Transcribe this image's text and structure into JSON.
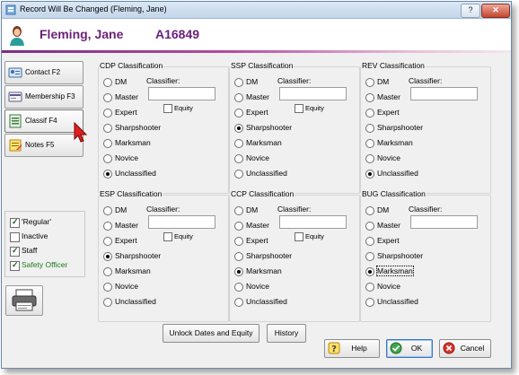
{
  "window": {
    "title": "Record Will Be Changed  (Fleming, Jane)",
    "help_glyph": "?",
    "close_glyph": "✕"
  },
  "header": {
    "name": "Fleming, Jane",
    "record_id": "A16849"
  },
  "nav": {
    "contact": "Contact  F2",
    "membership": "Membership F3",
    "classif": "Classif   F4",
    "notes": "Notes     F5"
  },
  "status": {
    "regular": {
      "label": "'Regular'",
      "checked": true
    },
    "inactive": {
      "label": "Inactive",
      "checked": false
    },
    "staff": {
      "label": "Staff",
      "checked": true
    },
    "safety_officer": {
      "label": "Safety Officer",
      "checked": true
    }
  },
  "classification": {
    "classifier_label": "Classifier:",
    "equity_label": "Equity",
    "levels": [
      "DM",
      "Master",
      "Expert",
      "Sharpshooter",
      "Marksman",
      "Novice",
      "Unclassified"
    ],
    "panels": [
      {
        "title": "CDP Classification",
        "selected": "Unclassified",
        "equity": false
      },
      {
        "title": "SSP Classification",
        "selected": "Sharpshooter",
        "equity": false
      },
      {
        "title": "REV Classification",
        "selected": "Unclassified",
        "equity": null
      },
      {
        "title": "ESP Classification",
        "selected": "Sharpshooter",
        "equity": false
      },
      {
        "title": "CCP Classification",
        "selected": "Marksman",
        "equity": false
      },
      {
        "title": "BUG Classification",
        "selected": "Marksman",
        "equity": null
      }
    ]
  },
  "buttons": {
    "unlock": "Unlock Dates and Equity",
    "history": "History",
    "help": "Help",
    "ok": "OK",
    "cancel": "Cancel"
  },
  "colors": {
    "name_purple": "#6b1e7a",
    "staff_green": "#1a7a1a"
  }
}
